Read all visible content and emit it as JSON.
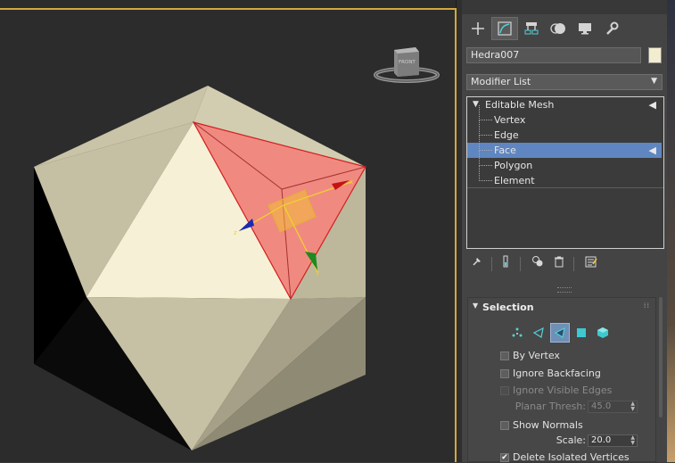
{
  "viewport": {
    "viewcube_label": "FRONT"
  },
  "panel": {
    "tabs": [
      {
        "name": "create",
        "icon": "plus-icon"
      },
      {
        "name": "modify",
        "icon": "modify-curve-icon"
      },
      {
        "name": "hierarchy",
        "icon": "hierarchy-icon"
      },
      {
        "name": "motion",
        "icon": "motion-icon"
      },
      {
        "name": "display",
        "icon": "display-monitor-icon"
      },
      {
        "name": "utilities",
        "icon": "wrench-icon"
      }
    ],
    "object_name": "Hedra007",
    "object_color": "#f3edd0",
    "modifier_list_label": "Modifier List",
    "stack": {
      "root_label": "Editable Mesh",
      "items": [
        {
          "label": "Vertex"
        },
        {
          "label": "Edge"
        },
        {
          "label": "Face"
        },
        {
          "label": "Polygon"
        },
        {
          "label": "Element"
        }
      ],
      "selected": "Face"
    },
    "stack_tools": [
      "pin-stack-icon",
      "show-end-result-icon",
      "make-unique-icon",
      "remove-modifier-icon",
      "configure-modifier-sets-icon"
    ]
  },
  "selection": {
    "title": "Selection",
    "sublevels": [
      "vertex-icon",
      "edge-icon",
      "face-icon",
      "polygon-icon",
      "element-icon"
    ],
    "active_sublevel": "face-icon",
    "by_vertex": {
      "label": "By Vertex",
      "checked": false
    },
    "ignore_backfacing": {
      "label": "Ignore Backfacing",
      "checked": false
    },
    "ignore_visible_edges": {
      "label": "Ignore Visible Edges",
      "checked": false,
      "disabled": true
    },
    "planar_thresh": {
      "label": "Planar Thresh:",
      "value": "45.0",
      "disabled": true
    },
    "show_normals": {
      "label": "Show Normals",
      "checked": false
    },
    "scale": {
      "label": "Scale:",
      "value": "20.0"
    },
    "delete_isolated": {
      "label": "Delete Isolated Vertices",
      "checked": true,
      "mark": "✔"
    }
  },
  "colors": {
    "highlight": "#5f86c0",
    "face_selection": "#f08a80",
    "viewport_border": "#d2a93c",
    "mesh": "#d8d2b6"
  }
}
